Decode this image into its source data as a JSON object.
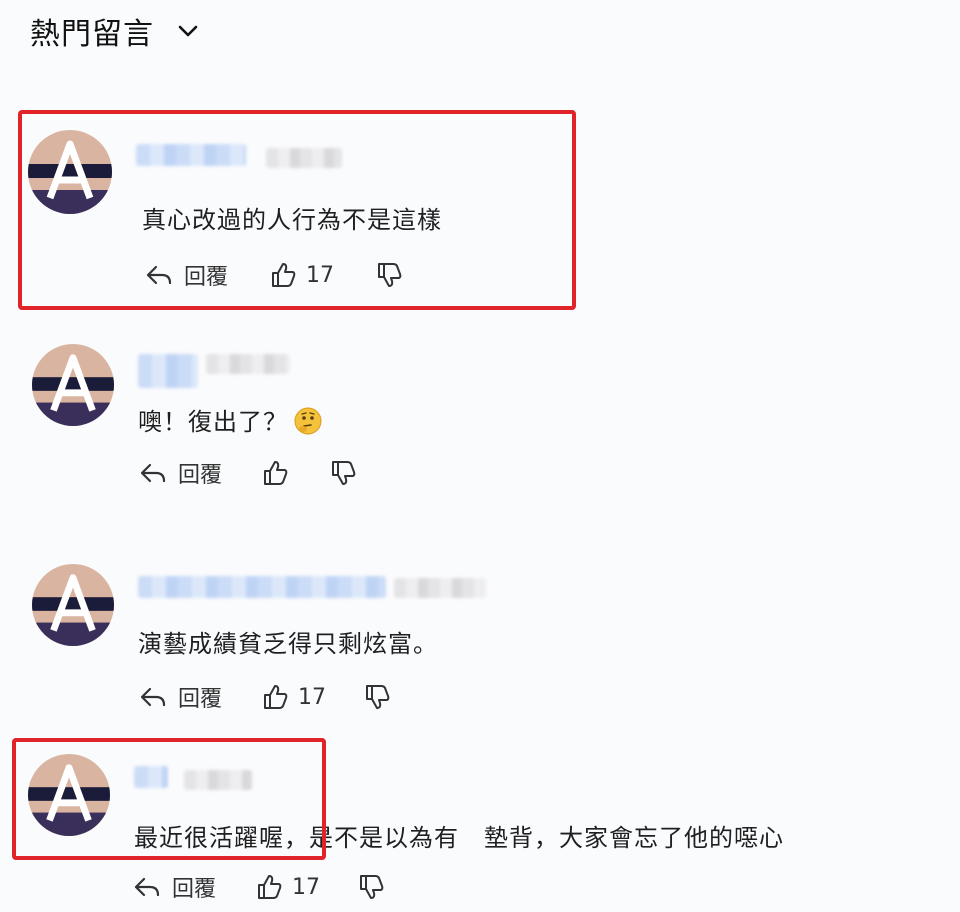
{
  "header": {
    "title": "熱門留言",
    "dropdown_icon": "chevron-down-icon"
  },
  "comments": [
    {
      "text": "真心改過的人行為不是這樣",
      "reply_label": "回覆",
      "likes": "17",
      "highlighted": true
    },
    {
      "text": "噢！復出了？",
      "emoji": "thinking-face",
      "reply_label": "回覆",
      "likes": "",
      "highlighted": false
    },
    {
      "text": "演藝成績貧乏得只剩炫富。",
      "reply_label": "回覆",
      "likes": "17",
      "highlighted": false
    },
    {
      "text": "最近很活躍喔，是不是以為有　墊背，大家會忘了他的噁心",
      "reply_label": "回覆",
      "likes": "17",
      "highlighted": true
    }
  ],
  "colors": {
    "highlight_border": "#e0242a",
    "background": "#fafbfd"
  }
}
